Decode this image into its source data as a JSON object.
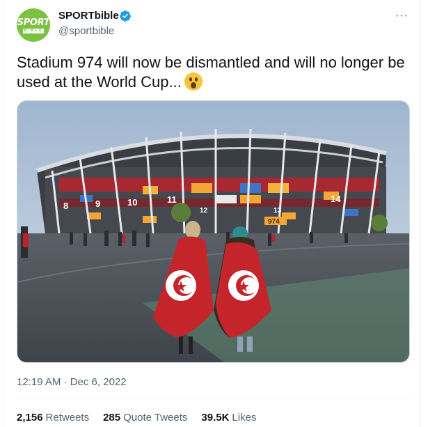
{
  "author": {
    "display_name": "SPORTbible",
    "handle": "@sportbible",
    "verified": true,
    "avatar_logo_top": "SPORT",
    "avatar_logo_bottom": "BIBLE",
    "brand_color": "#7cc242"
  },
  "menu": {
    "icon": "more-horizontal-icon",
    "label": "···"
  },
  "tweet": {
    "text": "Stadium 974 will now be dismantled and will no longer be used at the World Cup...",
    "emoji": "hushed-face",
    "timestamp": "12:19 AM · Dec 6, 2022"
  },
  "media": {
    "stadium_sign": "974",
    "gate_numbers": [
      "8",
      "9",
      "10",
      "11",
      "12",
      "13",
      "14"
    ]
  },
  "stats": [
    {
      "count": "2,156",
      "label": "Retweets"
    },
    {
      "count": "285",
      "label": "Quote Tweets"
    },
    {
      "count": "39.5K",
      "label": "Likes"
    }
  ],
  "colors": {
    "text": "#0f1419",
    "secondary": "#536471",
    "verified": "#1d9bf0",
    "divider": "#eff3f4"
  }
}
